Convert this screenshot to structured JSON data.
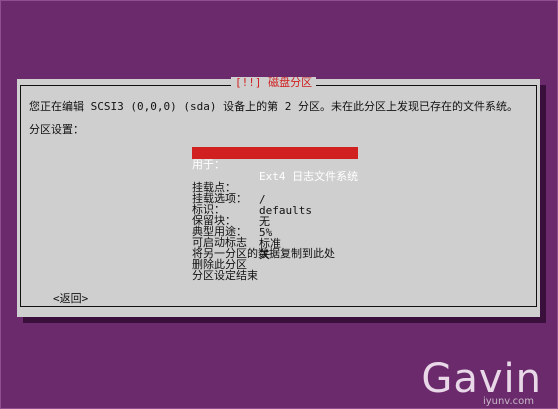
{
  "dialog": {
    "title": "[!!] 磁盘分区",
    "intro": "您正在编辑 SCSI3 (0,0,0) (sda) 设备上的第 2 分区。未在此分区上发现已存在的文件系统。",
    "section_label": "分区设置：",
    "selected": {
      "key": "用于：",
      "value": "Ext4 日志文件系统"
    },
    "fields": [
      {
        "key": "挂载点：",
        "value": "/"
      },
      {
        "key": "挂载选项：",
        "value": "defaults"
      },
      {
        "key": "标识：",
        "value": "无"
      },
      {
        "key": "保留块：",
        "value": "5%"
      },
      {
        "key": "典型用途：",
        "value": "标准"
      },
      {
        "key": "可启动标志",
        "value": "关"
      }
    ],
    "actions": [
      "将另一分区的数据复制到此处",
      "删除此分区",
      "分区设定结束"
    ],
    "back_label": "<返回>"
  },
  "watermark": {
    "text": "Gavin",
    "sub": "iyunv.com"
  }
}
